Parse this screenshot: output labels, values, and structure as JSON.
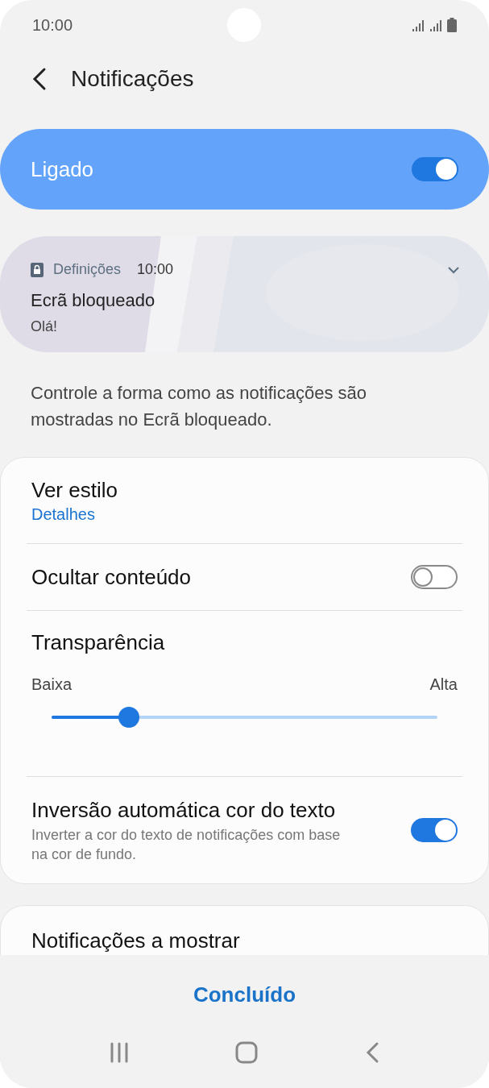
{
  "status_bar": {
    "time": "10:00"
  },
  "header": {
    "title": "Notificações"
  },
  "master_switch": {
    "label": "Ligado",
    "on": true
  },
  "preview": {
    "app": "Definições",
    "time": "10:00",
    "title": "Ecrã bloqueado",
    "body": "Olá!"
  },
  "description": "Controle a forma como as notificações são mostradas no Ecrã bloqueado.",
  "settings": [
    {
      "kind": "link",
      "title": "Ver estilo",
      "value": "Detalhes"
    },
    {
      "kind": "switch",
      "title": "Ocultar conteúdo",
      "on": false
    },
    {
      "kind": "slider",
      "title": "Transparência",
      "min_label": "Baixa",
      "max_label": "Alta",
      "level": 0.2
    },
    {
      "kind": "switch",
      "title": "Inversão automática cor do texto",
      "subtitle": "Inverter a cor do texto de notificações com base na cor de fundo.",
      "on": true
    }
  ],
  "next_section": {
    "title": "Notificações a mostrar"
  },
  "done_button": "Concluído"
}
